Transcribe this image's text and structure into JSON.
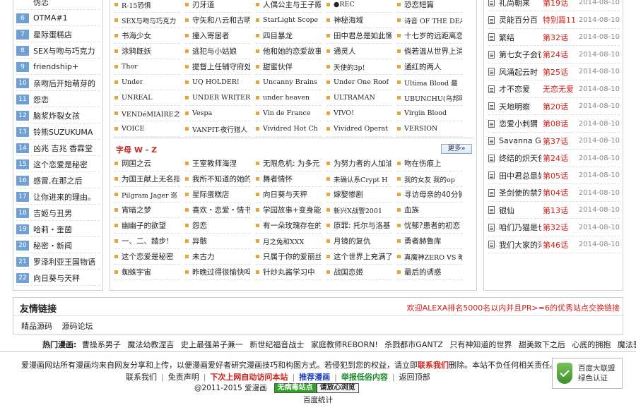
{
  "left_rank": [
    {
      "num": "",
      "title": "伪恋"
    },
    {
      "num": "6",
      "title": "OTMA#1"
    },
    {
      "num": "7",
      "title": "星际蛋糕店"
    },
    {
      "num": "8",
      "title": "SEX与吻与巧克力"
    },
    {
      "num": "9",
      "title": "friendship+"
    },
    {
      "num": "10",
      "title": "亲吻后开始萌芽的"
    },
    {
      "num": "11",
      "title": "怨恋"
    },
    {
      "num": "12",
      "title": "脑浆炸裂女孩"
    },
    {
      "num": "13",
      "title": "铃熊SUZUKUMA"
    },
    {
      "num": "14",
      "title": "凶兆 吉兆 香霖堂"
    },
    {
      "num": "15",
      "title": "这个恋爱是秘密"
    },
    {
      "num": "16",
      "title": "感冒,在那之后"
    },
    {
      "num": "17",
      "title": "让你进来的理由。"
    },
    {
      "num": "18",
      "title": "吉姬与丑男"
    },
    {
      "num": "19",
      "title": "哈莉・奎茵"
    },
    {
      "num": "20",
      "title": "秘密・新闻"
    },
    {
      "num": "21",
      "title": "罗泽利亚王国物语"
    },
    {
      "num": "22",
      "title": "向日葵与天秤"
    }
  ],
  "letter_list": {
    "rows": [
      [
        "R-15恐惧",
        "刃牙道",
        "人偶公主与王子殿",
        "●REC",
        "恐恋短篇"
      ],
      [
        "SEX与吻与巧克力",
        "守矢和八云和古明",
        "StarLight Scope",
        "神秘海域",
        "诗音 OF THE DEA"
      ],
      [
        "书海少女",
        "撞入寄居者",
        "四目暴龙",
        "田中君总是如此懒",
        "十七岁的远距离恋"
      ],
      [
        "涂鸦既妖",
        "逃犯与小姑娘",
        "他和她的恋爱故事",
        "通灵人",
        "倘若温从世界上消"
      ],
      [
        "Thor",
        "提督上任辅守府处",
        "甜蜜伙伴",
        "天使的3p!",
        "通红的两人"
      ],
      [
        "Under",
        "UQ HOLDER!",
        "Uncanny Brains",
        "Under One Roof",
        "Ultima Blood 最"
      ],
      [
        "UNREAL",
        "UNDER WRITER",
        "under heaven",
        "ULTRAMAN",
        "UBUNCHU(乌邦啾!)"
      ],
      [
        "VENDéMIAIRE之翼",
        "Vespa",
        "Vin de France",
        "VIVO!",
        "Virgin Blood"
      ],
      [
        "VOICE",
        "VANPIT-夜行猎人",
        "Vividred Hot Ch",
        "Vividred Operat",
        "VERSION"
      ]
    ],
    "section_title": "字母 W - Z",
    "more_label": "更多",
    "rows2": [
      [
        "网国之云",
        "王室教师海涅",
        "无限危机: 为多元",
        "为努力者的人加油",
        "吻在伤痕上"
      ],
      [
        "为国王献上无名指",
        "我所不知道的她的",
        "舞者情怀",
        "未确认系Crypt H",
        "我的女友 我的op"
      ],
      [
        "Pilgram Jager 巡",
        "星际蛋糕店",
        "向日葵与天秤",
        "嫁娶惨剧",
        "寻访母亲的40分钟"
      ],
      [
        "宵暗之梦",
        "喜欢・恋爱・情书",
        "学园故事+变身能力",
        "新兴X战警2001",
        "血族"
      ],
      [
        "幽幽子的欲望",
        "怨恋",
        "有一朵玫瑰存在的",
        "原罪: 托尔与洛基",
        "忧郁?患者的初恋"
      ],
      [
        "一、二、踏步!",
        "异骸",
        "月之兔和XXX",
        "月镜的复仇",
        "勇者赫鲁库"
      ],
      [
        "这个恋爱是秘密",
        "未古力",
        "只属于你的爱丽丝",
        "这个世界上充满了",
        "真魔神ZERO VS 暗"
      ],
      [
        "蜘蛛宇宙",
        "昨晚过得很愉快吗",
        "针炒丸酱学习中",
        "战国恋姬",
        "最后的诱惑"
      ]
    ]
  },
  "updates": [
    {
      "title": "礼尚朝来",
      "ep": "第19话",
      "date": "2014-08-10"
    },
    {
      "title": "灵能百分百",
      "ep": "特别篇11",
      "date": "2014-08-10"
    },
    {
      "title": "繁结",
      "ep": "第32话",
      "date": "2014-08-10"
    },
    {
      "title": "第七女子会彷",
      "ep": "第24话",
      "date": "2014-08-10"
    },
    {
      "title": "风涌起云时",
      "ep": "第25话",
      "date": "2014-08-10"
    },
    {
      "title": "才不恋爱",
      "ep": "无恋无爱",
      "date": "2014-08-10"
    },
    {
      "title": "天地明察",
      "ep": "第20话",
      "date": "2014-08-10"
    },
    {
      "title": "恋爱小刺猬",
      "ep": "第08话",
      "date": "2014-08-10"
    },
    {
      "title": "Savanna Game",
      "ep": "第37话",
      "date": "2014-08-10"
    },
    {
      "title": "终结的炽天使",
      "ep": "第24话",
      "date": "2014-08-10"
    },
    {
      "title": "田中君总是如",
      "ep": "第05话",
      "date": "2014-08-10"
    },
    {
      "title": "圣剑使的禁咒",
      "ep": "第04话",
      "date": "2014-08-10"
    },
    {
      "title": "银仙",
      "ep": "第13话",
      "date": "2014-08-10"
    },
    {
      "title": "咱们乃猫是也",
      "ep": "第32话",
      "date": "2014-08-10"
    },
    {
      "title": "我们大家的河",
      "ep": "第46话",
      "date": "2014-08-10"
    }
  ],
  "friend": {
    "title": "友情链接",
    "ad": "欢迎ALEXA排名5000名以内并且PR>=6的优秀站点交换链接",
    "links": [
      "精品源码",
      "源码论坛"
    ]
  },
  "hot": {
    "label": "热门漫画:",
    "links": [
      "曹操系男子",
      "魔法幼教涅吉",
      "史上最强弟子兼一",
      "新世纪福音战士",
      "家庭教师REBORN!",
      "杀戮都市GANTZ",
      "只有神知道的世界",
      "甜美致下之后",
      "心底的拥抱",
      "魔法骑士II"
    ]
  },
  "footer": {
    "notice_a": "爱漫画网站所有漫画均来自网友分享和上传，以便漫画爱好者研究漫画技巧和构图方式。若侵犯到您的权益，请立即",
    "notice_link": "联系我们",
    "notice_b": "删除。本站不负任何相关责任。",
    "nav": {
      "contact": "联系我们",
      "disclaimer": "免责声明",
      "auto_visit": "下次上网自动访问本站",
      "recommend": "推荐漫画",
      "report": "举报低俗内容",
      "back_top": "返回顶部",
      "sep": "|"
    },
    "copyright": "@2011-2015 爱漫画",
    "badge_green": "无病毒站点",
    "badge_light": "请放心浏览",
    "stat": "百度统计",
    "cert_line1": "百度大联盟",
    "cert_line2": "绿色认证"
  }
}
